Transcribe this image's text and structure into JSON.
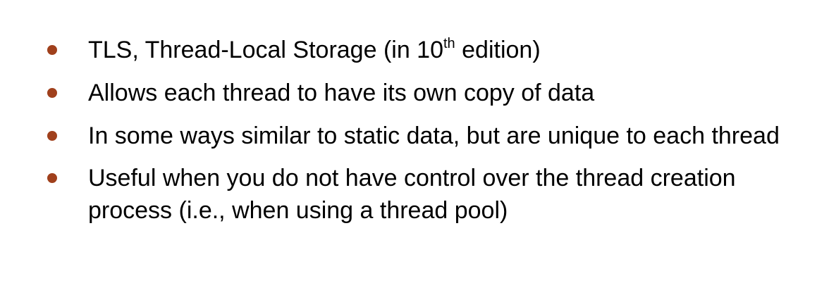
{
  "bullets": [
    {
      "before_sup": "TLS, Thread-Local Storage (in 10",
      "sup": "th",
      "after_sup": " edition)"
    },
    {
      "text": "Allows each thread to have its own copy of data"
    },
    {
      "text": "In some ways similar to static data, but are unique to each thread"
    },
    {
      "text": "Useful when you do not have control over the thread creation process (i.e., when using a thread pool)"
    }
  ],
  "colors": {
    "bullet": "#a0401c",
    "text": "#000000",
    "background": "#ffffff"
  }
}
